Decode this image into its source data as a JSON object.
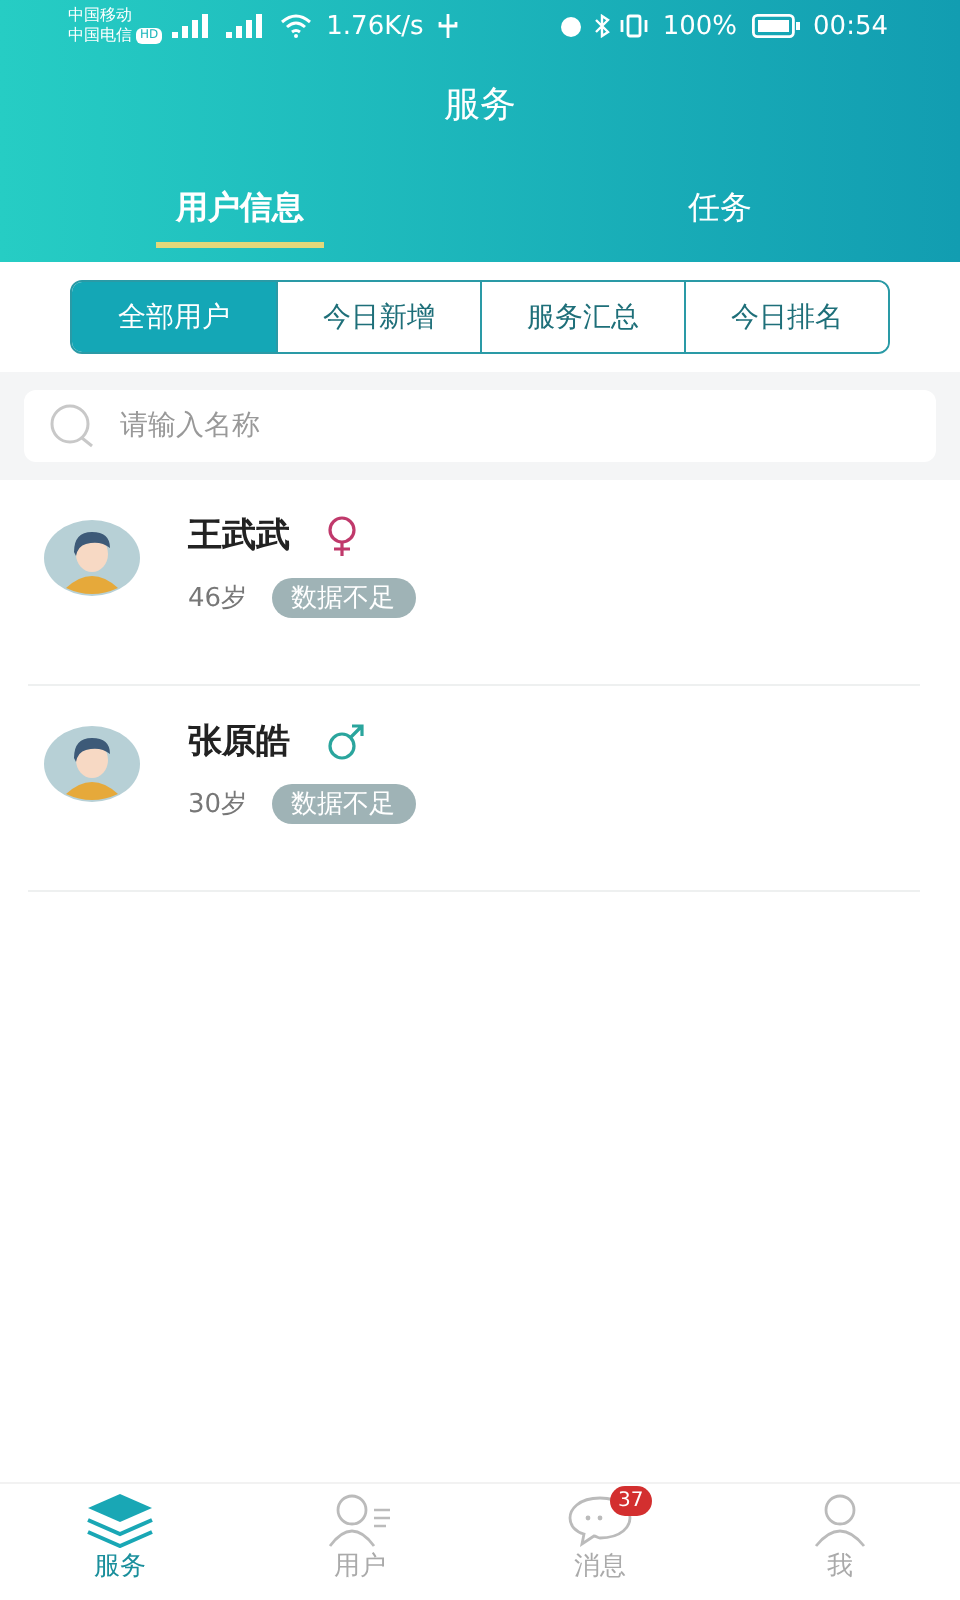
{
  "status_bar": {
    "carriers": [
      "中国移动",
      "中国电信"
    ],
    "hd_badge": "HD",
    "speed": "1.76K/s",
    "battery": "100%",
    "time": "00:54"
  },
  "title": "服务",
  "tabs": [
    {
      "label": "用户信息",
      "selected": true
    },
    {
      "label": "任务",
      "selected": false
    }
  ],
  "filters": [
    {
      "label": "全部用户",
      "selected": true
    },
    {
      "label": "今日新增",
      "selected": false
    },
    {
      "label": "服务汇总",
      "selected": false
    },
    {
      "label": "今日排名",
      "selected": false
    }
  ],
  "search": {
    "placeholder": "请输入名称"
  },
  "users": [
    {
      "name": "王武武",
      "kind": "female",
      "age": "46岁",
      "tag": "数据不足"
    },
    {
      "name": "张原皓",
      "kind": "male",
      "age": "30岁",
      "tag": "数据不足"
    }
  ],
  "nav": [
    {
      "kind": "layers",
      "label": "服务",
      "selected": true
    },
    {
      "kind": "user",
      "label": "用户",
      "selected": false
    },
    {
      "kind": "chat",
      "label": "消息",
      "selected": false,
      "badge": "37"
    },
    {
      "kind": "me",
      "label": "我",
      "selected": false
    }
  ]
}
